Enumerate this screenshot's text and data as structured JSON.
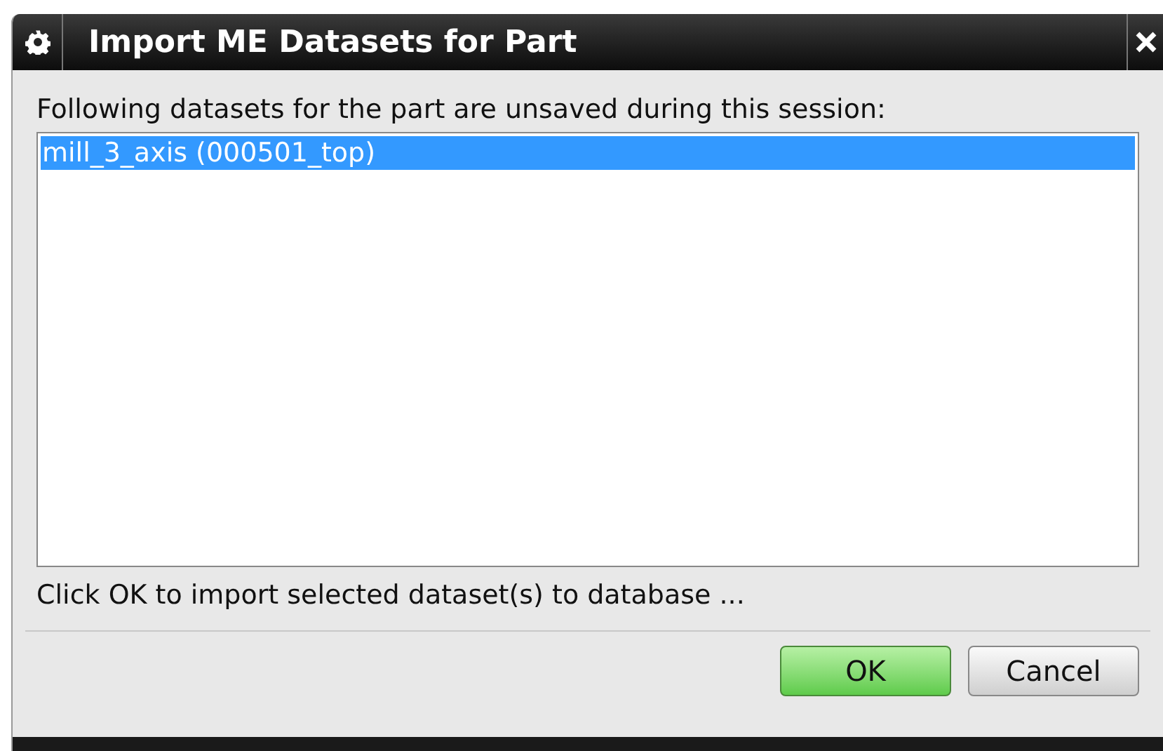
{
  "window": {
    "title": "Import ME Datasets for Part"
  },
  "message": "Following datasets for the part are unsaved during this session:",
  "datasets": [
    {
      "label": "mill_3_axis (000501_top)",
      "selected": true
    }
  ],
  "hint": "Click OK to import selected dataset(s) to database ...",
  "buttons": [
    {
      "label": "OK",
      "kind": "default"
    },
    {
      "label": "Cancel",
      "kind": "normal"
    }
  ]
}
